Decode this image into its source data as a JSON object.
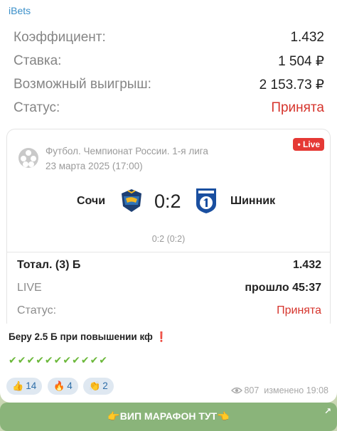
{
  "sender": "iBets",
  "summary": {
    "rows": [
      {
        "label": "Коэффициент:",
        "value": "1.432"
      },
      {
        "label": "Ставка:",
        "value": "1 504 ₽"
      },
      {
        "label": "Возможный выигрыш:",
        "value": "2 153.73 ₽"
      },
      {
        "label": "Статус:",
        "value": "Принята"
      }
    ]
  },
  "match": {
    "league": "Футбол. Чемпионат России. 1-я лига",
    "date": "23 марта 2025 (17:00)",
    "live_badge": "• Live",
    "home": "Сочи",
    "away": "Шинник",
    "score": "0:2",
    "halftime": "0:2 (0:2)",
    "bet": "Тотал. (3) Б",
    "bet_odds": "1.432",
    "live_label": "LIVE",
    "elapsed": "прошло 45:37",
    "status_label": "Статус:",
    "status_value": "Принята"
  },
  "message": {
    "text": "Беру 2.5 Б при повышении кф",
    "emphasis": "❗",
    "checks": "✔✔✔✔✔✔✔✔✔✔✔"
  },
  "reactions": [
    {
      "emoji": "👍",
      "count": "14"
    },
    {
      "emoji": "🔥",
      "count": "4"
    },
    {
      "emoji": "👏",
      "count": "2"
    }
  ],
  "meta": {
    "views": "807",
    "edited": "изменено 19:08"
  },
  "banner": {
    "label": "👉ВИП МАРАФОН ТУТ👈",
    "arrow": "↗"
  },
  "colors": {
    "accent_red": "#d6342c",
    "live_red": "#e53935",
    "sender_blue": "#3a8fc9",
    "banner_green": "#8ab47a",
    "reaction_bg": "#dfe8f1"
  }
}
